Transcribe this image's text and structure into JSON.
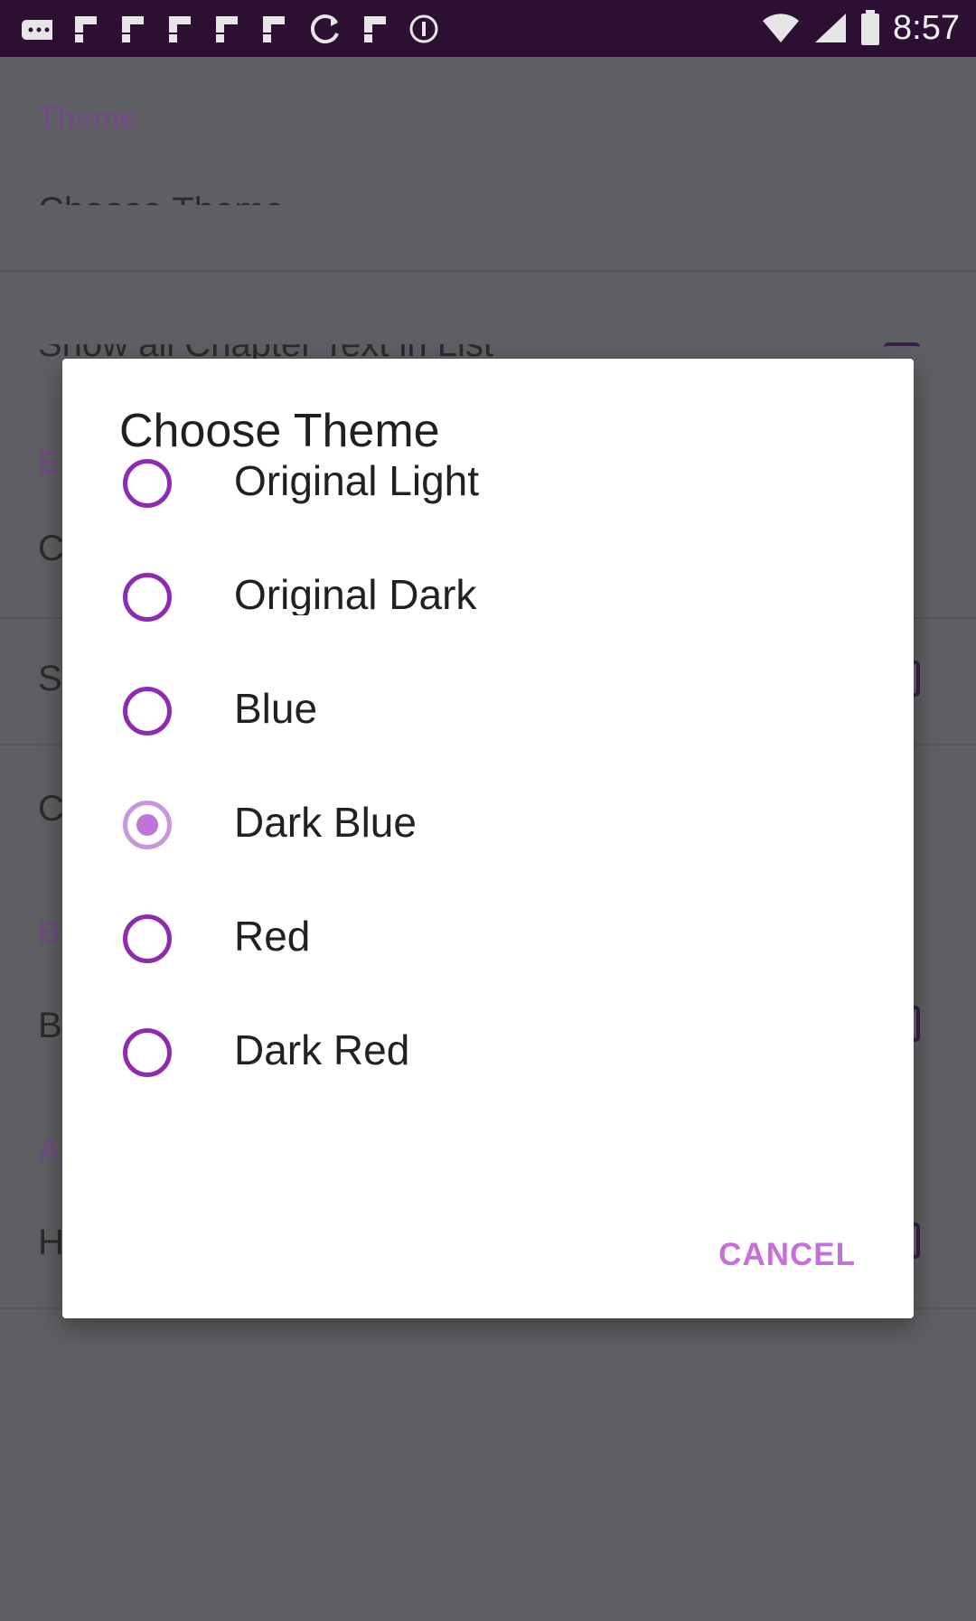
{
  "status_bar": {
    "time": "8:57",
    "icons": [
      "chat-icon",
      "flipboard-icon",
      "flipboard-icon",
      "flipboard-icon",
      "flipboard-icon",
      "flipboard-icon",
      "sync-icon",
      "flipboard-icon",
      "info-icon"
    ]
  },
  "background": {
    "category_theme": "Theme",
    "item_choose_theme": "Choose Theme",
    "item_show_chapter": "Show all Chapter Text in List",
    "category_e": "E",
    "item_c1": "C",
    "item_s": "S",
    "item_c2": "C",
    "category_b": "B",
    "item_b": "B",
    "category_a": "A",
    "item_h": "H"
  },
  "dialog": {
    "title": "Choose Theme",
    "options": [
      {
        "label": "Original Light",
        "checked": false
      },
      {
        "label": "Original Dark",
        "checked": false
      },
      {
        "label": "Blue",
        "checked": false
      },
      {
        "label": "Dark Blue",
        "checked": true
      },
      {
        "label": "Red",
        "checked": false
      },
      {
        "label": "Dark Red",
        "checked": false
      }
    ],
    "cancel_label": "CANCEL"
  },
  "colors": {
    "accent": "#8e2bb0",
    "accent_light": "#c66fd9",
    "status_bar": "#2c0f33",
    "scrim": "#5f6063"
  }
}
